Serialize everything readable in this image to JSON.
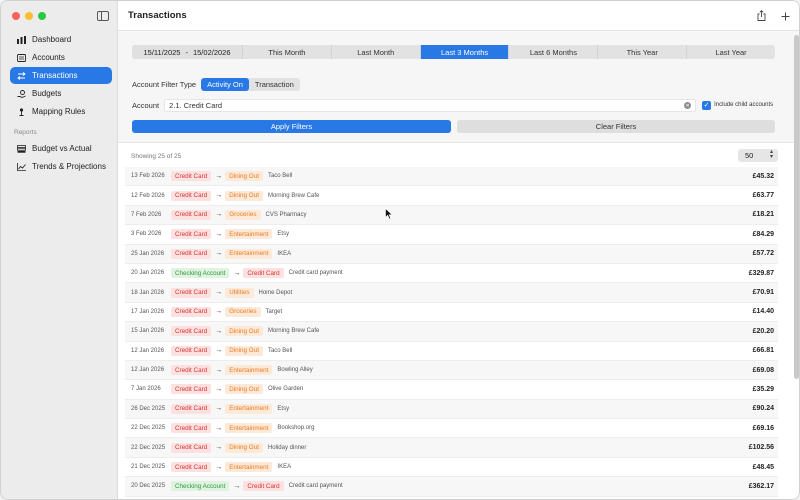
{
  "window": {
    "title": "Transactions"
  },
  "sidebar": {
    "items": [
      {
        "label": "Dashboard",
        "icon": "chart-bar-icon"
      },
      {
        "label": "Accounts",
        "icon": "list-icon"
      },
      {
        "label": "Transactions",
        "icon": "transfer-arrows-icon",
        "active": true
      },
      {
        "label": "Budgets",
        "icon": "hand-coin-icon"
      },
      {
        "label": "Mapping Rules",
        "icon": "pin-icon"
      }
    ],
    "reports_section": "Reports",
    "reports": [
      {
        "label": "Budget vs Actual",
        "icon": "stack-icon"
      },
      {
        "label": "Trends & Projections",
        "icon": "trend-line-icon"
      }
    ]
  },
  "filters": {
    "date_from": "15/11/2025",
    "date_sep": "-",
    "date_to": "15/02/2026",
    "presets": [
      "This Month",
      "Last Month",
      "Last 3 Months",
      "Last 6 Months",
      "This Year",
      "Last Year"
    ],
    "selected_preset": "Last 3 Months",
    "account_filter_type_label": "Account Filter Type",
    "filter_types": [
      "Activity On",
      "Transaction"
    ],
    "selected_filter_type": "Activity On",
    "account_label": "Account",
    "account_value": "2.1. Credit Card",
    "include_child_label": "Include child accounts",
    "include_child_checked": true,
    "apply_label": "Apply Filters",
    "clear_label": "Clear Filters"
  },
  "list": {
    "showing_text": "Showing 25 of 25",
    "page_size": "50",
    "rows": [
      {
        "date": "13 Feb 2026",
        "from": "Credit Card",
        "from_color": "red",
        "to": "Dining Out",
        "to_color": "orange",
        "desc": "Taco Bell",
        "amount": "£45.32"
      },
      {
        "date": "12 Feb 2026",
        "from": "Credit Card",
        "from_color": "red",
        "to": "Dining Out",
        "to_color": "orange",
        "desc": "Morning Brew Cafe",
        "amount": "£63.77"
      },
      {
        "date": "7 Feb 2026",
        "from": "Credit Card",
        "from_color": "red",
        "to": "Groceries",
        "to_color": "orange",
        "desc": "CVS Pharmacy",
        "amount": "£18.21"
      },
      {
        "date": "3 Feb 2026",
        "from": "Credit Card",
        "from_color": "red",
        "to": "Entertainment",
        "to_color": "orange",
        "desc": "Etsy",
        "amount": "£84.29"
      },
      {
        "date": "25 Jan 2026",
        "from": "Credit Card",
        "from_color": "red",
        "to": "Entertainment",
        "to_color": "orange",
        "desc": "IKEA",
        "amount": "£57.72"
      },
      {
        "date": "20 Jan 2026",
        "from": "Checking Account",
        "from_color": "green",
        "to": "Credit Card",
        "to_color": "red",
        "desc": "Credit card payment",
        "amount": "£329.87"
      },
      {
        "date": "18 Jan 2026",
        "from": "Credit Card",
        "from_color": "red",
        "to": "Utilities",
        "to_color": "orange",
        "desc": "Home Depot",
        "amount": "£70.91"
      },
      {
        "date": "17 Jan 2026",
        "from": "Credit Card",
        "from_color": "red",
        "to": "Groceries",
        "to_color": "orange",
        "desc": "Target",
        "amount": "£14.40"
      },
      {
        "date": "15 Jan 2026",
        "from": "Credit Card",
        "from_color": "red",
        "to": "Dining Out",
        "to_color": "orange",
        "desc": "Morning Brew Cafe",
        "amount": "£20.20"
      },
      {
        "date": "12 Jan 2026",
        "from": "Credit Card",
        "from_color": "red",
        "to": "Dining Out",
        "to_color": "orange",
        "desc": "Taco Bell",
        "amount": "£66.81"
      },
      {
        "date": "12 Jan 2026",
        "from": "Credit Card",
        "from_color": "red",
        "to": "Entertainment",
        "to_color": "orange",
        "desc": "Bowling Alley",
        "amount": "£69.08"
      },
      {
        "date": "7 Jan 2026",
        "from": "Credit Card",
        "from_color": "red",
        "to": "Dining Out",
        "to_color": "orange",
        "desc": "Olive Garden",
        "amount": "£35.29"
      },
      {
        "date": "26 Dec 2025",
        "from": "Credit Card",
        "from_color": "red",
        "to": "Entertainment",
        "to_color": "orange",
        "desc": "Etsy",
        "amount": "£90.24"
      },
      {
        "date": "22 Dec 2025",
        "from": "Credit Card",
        "from_color": "red",
        "to": "Entertainment",
        "to_color": "orange",
        "desc": "Bookshop.org",
        "amount": "£69.16"
      },
      {
        "date": "22 Dec 2025",
        "from": "Credit Card",
        "from_color": "red",
        "to": "Dining Out",
        "to_color": "orange",
        "desc": "Holiday dinner",
        "amount": "£102.56"
      },
      {
        "date": "21 Dec 2025",
        "from": "Credit Card",
        "from_color": "red",
        "to": "Entertainment",
        "to_color": "orange",
        "desc": "IKEA",
        "amount": "£48.45"
      },
      {
        "date": "20 Dec 2025",
        "from": "Checking Account",
        "from_color": "green",
        "to": "Credit Card",
        "to_color": "red",
        "desc": "Credit card payment",
        "amount": "£362.17"
      }
    ]
  },
  "colors": {
    "accent": "#2879e6",
    "tag_red": "#d8322f",
    "tag_orange": "#ea7a21",
    "tag_green": "#2f9a3d"
  }
}
